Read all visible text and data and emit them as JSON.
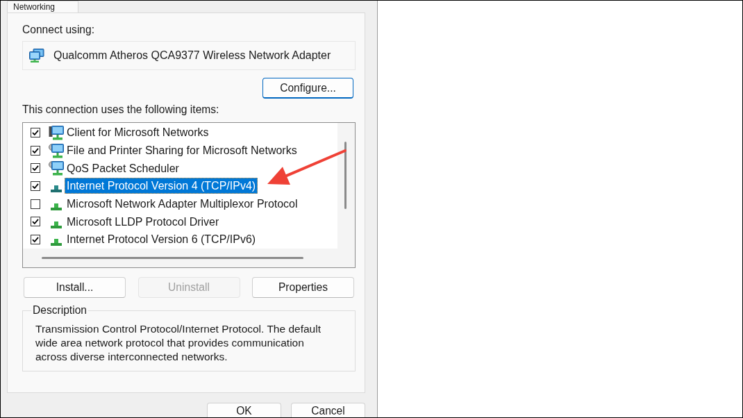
{
  "tab": {
    "label": "Networking",
    "selected": true
  },
  "connect_using": {
    "label": "Connect using:",
    "adapter": "Qualcomm Atheros QCA9377 Wireless Network Adapter"
  },
  "configure_button": {
    "label": "Configure...",
    "focused": true
  },
  "items_label": "This connection uses the following items:",
  "items": [
    {
      "label": "Client for Microsoft Networks",
      "kind": "client",
      "checked": true,
      "selected": false
    },
    {
      "label": "File and Printer Sharing for Microsoft Networks",
      "kind": "service",
      "checked": true,
      "selected": false
    },
    {
      "label": "QoS Packet Scheduler",
      "kind": "service",
      "checked": true,
      "selected": false
    },
    {
      "label": "Internet Protocol Version 4 (TCP/IPv4)",
      "kind": "protocol",
      "checked": true,
      "selected": true
    },
    {
      "label": "Microsoft Network Adapter Multiplexor Protocol",
      "kind": "protocol",
      "checked": false,
      "selected": false
    },
    {
      "label": "Microsoft LLDP Protocol Driver",
      "kind": "protocol",
      "checked": true,
      "selected": false
    },
    {
      "label": "Internet Protocol Version 6 (TCP/IPv6)",
      "kind": "protocol",
      "checked": true,
      "selected": false
    }
  ],
  "item_buttons": [
    {
      "label": "Install...",
      "disabled": false
    },
    {
      "label": "Uninstall",
      "disabled": true
    },
    {
      "label": "Properties",
      "disabled": false
    }
  ],
  "description": {
    "title": "Description",
    "text": "Transmission Control Protocol/Internet Protocol. The default wide area network protocol that provides communication across diverse interconnected networks."
  },
  "dialog_buttons": [
    {
      "label": "OK"
    },
    {
      "label": "Cancel"
    }
  ]
}
